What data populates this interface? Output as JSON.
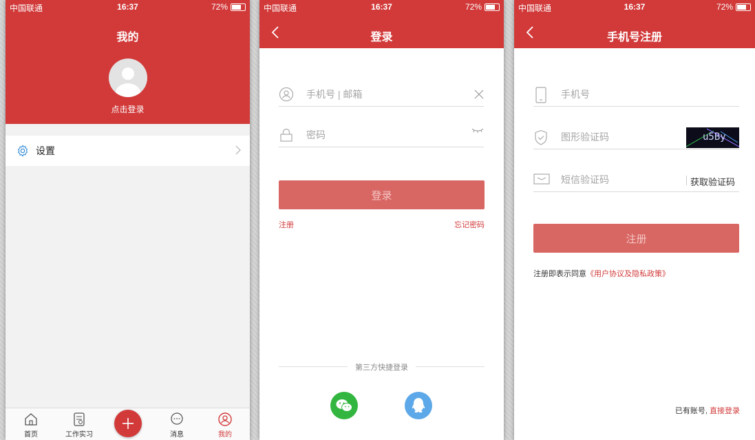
{
  "status": {
    "carrier": "中国联通",
    "time": "16:37",
    "battery": "72%"
  },
  "screen1": {
    "title": "我的",
    "login_prompt": "点击登录",
    "settings_label": "设置",
    "tabs": [
      {
        "label": "首页"
      },
      {
        "label": "工作实习"
      },
      {
        "label": "消息"
      },
      {
        "label": "我的"
      }
    ],
    "active_tab_color": "#d23a3a"
  },
  "screen2": {
    "title": "登录",
    "account_placeholder": "手机号 | 邮箱",
    "password_placeholder": "密码",
    "login_button": "登录",
    "register_link": "注册",
    "forgot_link": "忘记密码",
    "third_party_label": "第三方快捷登录",
    "social": [
      "wechat-icon",
      "qq-icon"
    ]
  },
  "screen3": {
    "title": "手机号注册",
    "phone_placeholder": "手机号",
    "captcha_placeholder": "图形验证码",
    "captcha_text": "u5By",
    "sms_placeholder": "短信验证码",
    "get_code_label": "获取验证码",
    "register_button": "注册",
    "agreement_prefix": "注册即表示同意",
    "agreement_link": "《用户协议及隐私政策》",
    "has_account": "已有账号,",
    "direct_login": "直接登录"
  },
  "colors": {
    "brand_red": "#d23a3a",
    "button_red": "#d86663"
  }
}
